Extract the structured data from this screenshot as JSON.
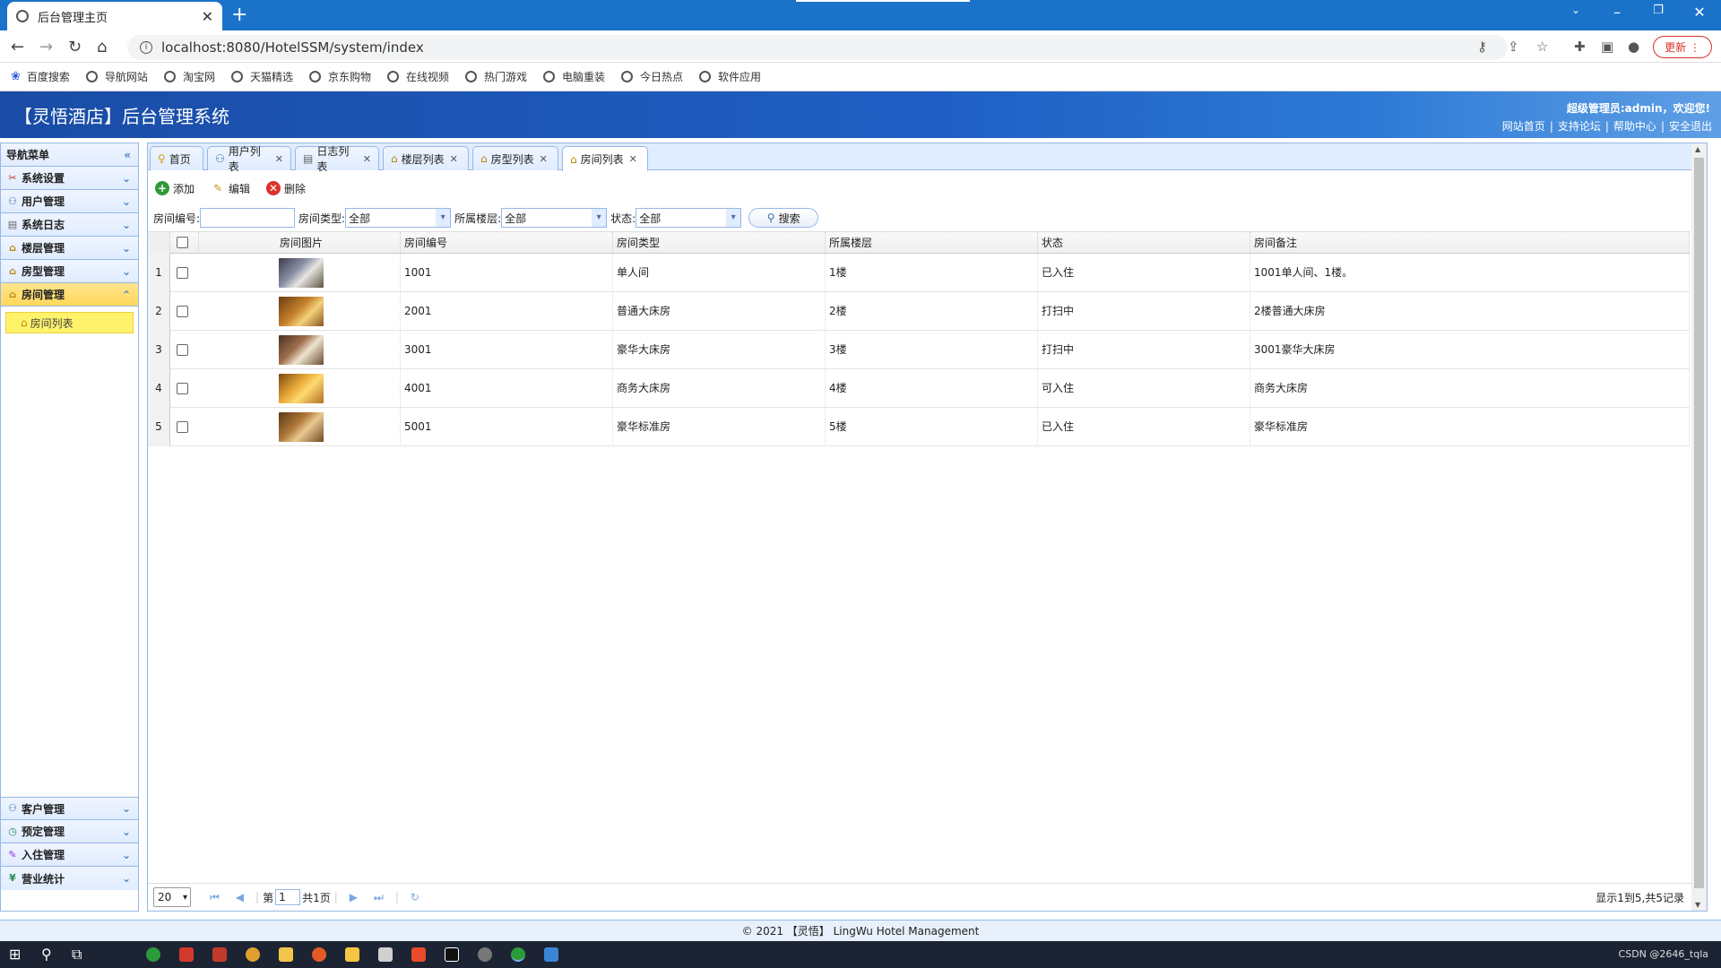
{
  "browser": {
    "tab_title": "后台管理主页",
    "url": "localhost:8080/HotelSSM/system/index",
    "update_label": "更新",
    "bookmarks": [
      "百度搜索",
      "导航网站",
      "淘宝网",
      "天猫精选",
      "京东购物",
      "在线视频",
      "热门游戏",
      "电脑重装",
      "今日热点",
      "软件应用"
    ]
  },
  "header": {
    "title": "【灵悟酒店】后台管理系统",
    "welcome": "超级管理员:admin，欢迎您!",
    "links": [
      "网站首页",
      "支持论坛",
      "帮助中心",
      "安全退出"
    ]
  },
  "sidebar": {
    "title": "导航菜单",
    "top_items": [
      {
        "label": "系统设置",
        "icon": "tools-icon"
      },
      {
        "label": "用户管理",
        "icon": "user-icon"
      },
      {
        "label": "系统日志",
        "icon": "log-icon"
      },
      {
        "label": "楼层管理",
        "icon": "building-icon"
      },
      {
        "label": "房型管理",
        "icon": "house-icon"
      },
      {
        "label": "房间管理",
        "icon": "house-icon"
      }
    ],
    "active_sub": "房间列表",
    "bottom_items": [
      {
        "label": "客户管理",
        "icon": "customer-icon"
      },
      {
        "label": "预定管理",
        "icon": "clock-icon"
      },
      {
        "label": "入住管理",
        "icon": "checkin-icon"
      },
      {
        "label": "营业统计",
        "icon": "stats-icon"
      }
    ]
  },
  "tabs": [
    {
      "label": "首页",
      "closable": false
    },
    {
      "label": "用户列表",
      "closable": true
    },
    {
      "label": "日志列表",
      "closable": true
    },
    {
      "label": "楼层列表",
      "closable": true
    },
    {
      "label": "房型列表",
      "closable": true
    },
    {
      "label": "房间列表",
      "closable": true,
      "selected": true
    }
  ],
  "toolbar": {
    "add": "添加",
    "edit": "编辑",
    "delete": "删除"
  },
  "search": {
    "room_no_label": "房间编号:",
    "room_no_value": "",
    "type_label": "房间类型:",
    "type_value": "全部",
    "floor_label": "所属楼层:",
    "floor_value": "全部",
    "status_label": "状态:",
    "status_value": "全部",
    "button": "搜索"
  },
  "grid": {
    "columns": [
      "房间图片",
      "房间编号",
      "房间类型",
      "所属楼层",
      "状态",
      "房间备注"
    ],
    "rows": [
      {
        "n": "1",
        "no": "1001",
        "type": "单人间",
        "floor": "1楼",
        "status": "已入住",
        "note": "1001单人间、1楼。"
      },
      {
        "n": "2",
        "no": "2001",
        "type": "普通大床房",
        "floor": "2楼",
        "status": "打扫中",
        "note": "2楼普通大床房"
      },
      {
        "n": "3",
        "no": "3001",
        "type": "豪华大床房",
        "floor": "3楼",
        "status": "打扫中",
        "note": "3001豪华大床房"
      },
      {
        "n": "4",
        "no": "4001",
        "type": "商务大床房",
        "floor": "4楼",
        "status": "可入住",
        "note": "商务大床房"
      },
      {
        "n": "5",
        "no": "5001",
        "type": "豪华标准房",
        "floor": "5楼",
        "status": "已入住",
        "note": "豪华标准房"
      }
    ]
  },
  "pager": {
    "page_size": "20",
    "page_prefix": "第",
    "page_value": "1",
    "page_total": "共1页",
    "info": "显示1到5,共5记录"
  },
  "footer": "© 2021 【灵悟】 LingWu Hotel Management",
  "taskbar": {
    "watermark": "CSDN @2646_tqla"
  }
}
